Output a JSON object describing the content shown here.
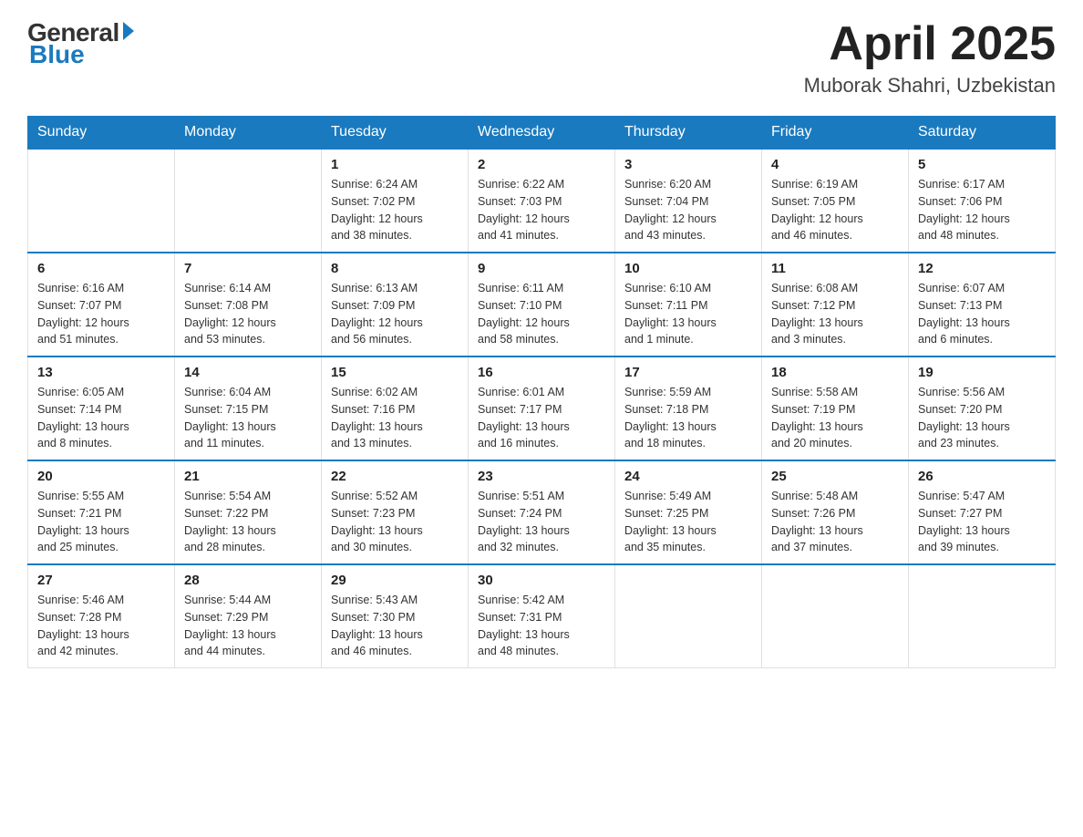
{
  "header": {
    "logo_general": "General",
    "logo_blue": "Blue",
    "title": "April 2025",
    "location": "Muborak Shahri, Uzbekistan"
  },
  "days_of_week": [
    "Sunday",
    "Monday",
    "Tuesday",
    "Wednesday",
    "Thursday",
    "Friday",
    "Saturday"
  ],
  "weeks": [
    [
      {
        "day": "",
        "info": ""
      },
      {
        "day": "",
        "info": ""
      },
      {
        "day": "1",
        "info": "Sunrise: 6:24 AM\nSunset: 7:02 PM\nDaylight: 12 hours\nand 38 minutes."
      },
      {
        "day": "2",
        "info": "Sunrise: 6:22 AM\nSunset: 7:03 PM\nDaylight: 12 hours\nand 41 minutes."
      },
      {
        "day": "3",
        "info": "Sunrise: 6:20 AM\nSunset: 7:04 PM\nDaylight: 12 hours\nand 43 minutes."
      },
      {
        "day": "4",
        "info": "Sunrise: 6:19 AM\nSunset: 7:05 PM\nDaylight: 12 hours\nand 46 minutes."
      },
      {
        "day": "5",
        "info": "Sunrise: 6:17 AM\nSunset: 7:06 PM\nDaylight: 12 hours\nand 48 minutes."
      }
    ],
    [
      {
        "day": "6",
        "info": "Sunrise: 6:16 AM\nSunset: 7:07 PM\nDaylight: 12 hours\nand 51 minutes."
      },
      {
        "day": "7",
        "info": "Sunrise: 6:14 AM\nSunset: 7:08 PM\nDaylight: 12 hours\nand 53 minutes."
      },
      {
        "day": "8",
        "info": "Sunrise: 6:13 AM\nSunset: 7:09 PM\nDaylight: 12 hours\nand 56 minutes."
      },
      {
        "day": "9",
        "info": "Sunrise: 6:11 AM\nSunset: 7:10 PM\nDaylight: 12 hours\nand 58 minutes."
      },
      {
        "day": "10",
        "info": "Sunrise: 6:10 AM\nSunset: 7:11 PM\nDaylight: 13 hours\nand 1 minute."
      },
      {
        "day": "11",
        "info": "Sunrise: 6:08 AM\nSunset: 7:12 PM\nDaylight: 13 hours\nand 3 minutes."
      },
      {
        "day": "12",
        "info": "Sunrise: 6:07 AM\nSunset: 7:13 PM\nDaylight: 13 hours\nand 6 minutes."
      }
    ],
    [
      {
        "day": "13",
        "info": "Sunrise: 6:05 AM\nSunset: 7:14 PM\nDaylight: 13 hours\nand 8 minutes."
      },
      {
        "day": "14",
        "info": "Sunrise: 6:04 AM\nSunset: 7:15 PM\nDaylight: 13 hours\nand 11 minutes."
      },
      {
        "day": "15",
        "info": "Sunrise: 6:02 AM\nSunset: 7:16 PM\nDaylight: 13 hours\nand 13 minutes."
      },
      {
        "day": "16",
        "info": "Sunrise: 6:01 AM\nSunset: 7:17 PM\nDaylight: 13 hours\nand 16 minutes."
      },
      {
        "day": "17",
        "info": "Sunrise: 5:59 AM\nSunset: 7:18 PM\nDaylight: 13 hours\nand 18 minutes."
      },
      {
        "day": "18",
        "info": "Sunrise: 5:58 AM\nSunset: 7:19 PM\nDaylight: 13 hours\nand 20 minutes."
      },
      {
        "day": "19",
        "info": "Sunrise: 5:56 AM\nSunset: 7:20 PM\nDaylight: 13 hours\nand 23 minutes."
      }
    ],
    [
      {
        "day": "20",
        "info": "Sunrise: 5:55 AM\nSunset: 7:21 PM\nDaylight: 13 hours\nand 25 minutes."
      },
      {
        "day": "21",
        "info": "Sunrise: 5:54 AM\nSunset: 7:22 PM\nDaylight: 13 hours\nand 28 minutes."
      },
      {
        "day": "22",
        "info": "Sunrise: 5:52 AM\nSunset: 7:23 PM\nDaylight: 13 hours\nand 30 minutes."
      },
      {
        "day": "23",
        "info": "Sunrise: 5:51 AM\nSunset: 7:24 PM\nDaylight: 13 hours\nand 32 minutes."
      },
      {
        "day": "24",
        "info": "Sunrise: 5:49 AM\nSunset: 7:25 PM\nDaylight: 13 hours\nand 35 minutes."
      },
      {
        "day": "25",
        "info": "Sunrise: 5:48 AM\nSunset: 7:26 PM\nDaylight: 13 hours\nand 37 minutes."
      },
      {
        "day": "26",
        "info": "Sunrise: 5:47 AM\nSunset: 7:27 PM\nDaylight: 13 hours\nand 39 minutes."
      }
    ],
    [
      {
        "day": "27",
        "info": "Sunrise: 5:46 AM\nSunset: 7:28 PM\nDaylight: 13 hours\nand 42 minutes."
      },
      {
        "day": "28",
        "info": "Sunrise: 5:44 AM\nSunset: 7:29 PM\nDaylight: 13 hours\nand 44 minutes."
      },
      {
        "day": "29",
        "info": "Sunrise: 5:43 AM\nSunset: 7:30 PM\nDaylight: 13 hours\nand 46 minutes."
      },
      {
        "day": "30",
        "info": "Sunrise: 5:42 AM\nSunset: 7:31 PM\nDaylight: 13 hours\nand 48 minutes."
      },
      {
        "day": "",
        "info": ""
      },
      {
        "day": "",
        "info": ""
      },
      {
        "day": "",
        "info": ""
      }
    ]
  ]
}
